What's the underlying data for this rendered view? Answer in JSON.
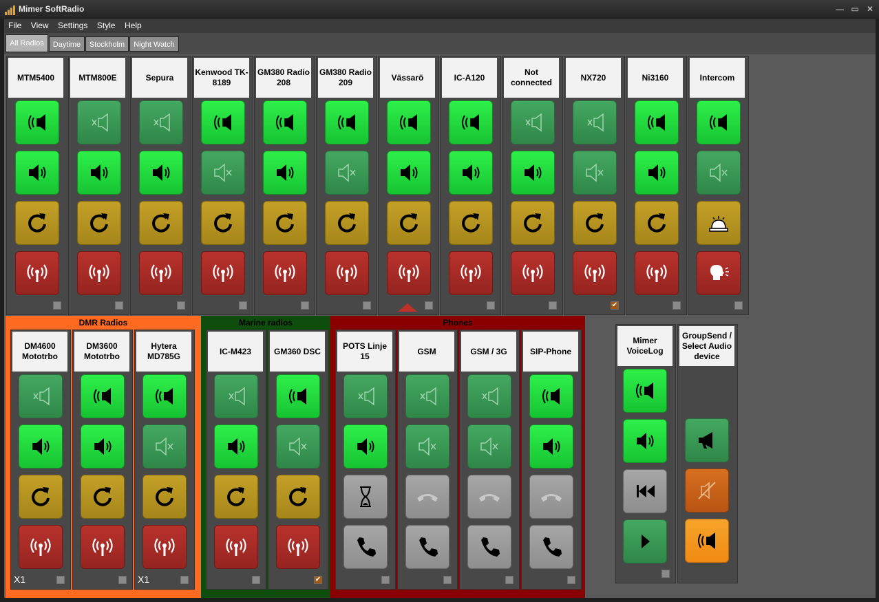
{
  "window": {
    "title": "Mimer SoftRadio"
  },
  "menu": [
    "File",
    "View",
    "Settings",
    "Style",
    "Help"
  ],
  "tabs": [
    "All Radios",
    "Daytime",
    "Stockholm",
    "Night Watch"
  ],
  "top_radios": [
    {
      "label": "MTM5400",
      "ptt": true,
      "speaker": true,
      "btn3": "refresh",
      "btn4": "antenna",
      "checked": false
    },
    {
      "label": "MTM800E",
      "ptt": false,
      "speaker": true,
      "btn3": "refresh",
      "btn4": "antenna",
      "checked": false
    },
    {
      "label": "Sepura",
      "ptt": false,
      "speaker": true,
      "btn3": "refresh",
      "btn4": "antenna",
      "checked": false
    },
    {
      "label": "Kenwood TK-8189",
      "ptt": true,
      "speaker": false,
      "btn3": "refresh",
      "btn4": "antenna",
      "checked": false
    },
    {
      "label": "GM380 Radio 208",
      "ptt": true,
      "speaker": true,
      "btn3": "refresh",
      "btn4": "antenna",
      "checked": false
    },
    {
      "label": "GM380 Radio 209",
      "ptt": true,
      "speaker": false,
      "btn3": "refresh",
      "btn4": "antenna",
      "checked": false
    },
    {
      "label": "Vässarö",
      "ptt": true,
      "speaker": true,
      "btn3": "refresh",
      "btn4": "antenna",
      "checked": false,
      "selected": true
    },
    {
      "label": "IC-A120",
      "ptt": true,
      "speaker": true,
      "btn3": "refresh",
      "btn4": "antenna",
      "checked": false
    },
    {
      "label": "Not connected",
      "ptt": false,
      "speaker": true,
      "btn3": "refresh",
      "btn4": "antenna",
      "checked": false
    },
    {
      "label": "NX720",
      "ptt": false,
      "speaker": false,
      "btn3": "refresh",
      "btn4": "antenna",
      "checked": true
    },
    {
      "label": "Ni3160",
      "ptt": true,
      "speaker": true,
      "btn3": "refresh",
      "btn4": "antenna",
      "checked": false
    },
    {
      "label": "Intercom",
      "ptt": true,
      "speaker": false,
      "btn3": "bell",
      "btn4": "voice",
      "checked": false
    }
  ],
  "groups": [
    {
      "name": "DMR Radios",
      "color": "#ff6a21",
      "radios": [
        {
          "label": "DM4600 Mototrbo",
          "ptt": false,
          "speaker": true,
          "btn3": "refresh",
          "btn4": "antenna",
          "checked": false,
          "tag": "X1"
        },
        {
          "label": "DM3600 Mototrbo",
          "ptt": true,
          "speaker": true,
          "btn3": "refresh",
          "btn4": "antenna",
          "checked": false,
          "tag": ""
        },
        {
          "label": "Hytera MD785G",
          "ptt": true,
          "speaker": false,
          "btn3": "refresh",
          "btn4": "antenna",
          "checked": false,
          "tag": "X1"
        }
      ]
    },
    {
      "name": "Marine radios",
      "color": "#0f4d0f",
      "radios": [
        {
          "label": "IC-M423",
          "ptt": false,
          "speaker": true,
          "btn3": "refresh",
          "btn4": "antenna",
          "checked": false,
          "tag": ""
        },
        {
          "label": "GM360 DSC",
          "ptt": true,
          "speaker": false,
          "btn3": "refresh",
          "btn4": "antenna",
          "checked": true,
          "tag": ""
        }
      ]
    },
    {
      "name": "Phones",
      "color": "#8a0000",
      "radios": [
        {
          "label": "POTS Linje 15",
          "ptt": false,
          "speaker": true,
          "btn3": "hourglass",
          "btn4": "phone",
          "checked": false,
          "tag": ""
        },
        {
          "label": "GSM",
          "ptt": false,
          "speaker": false,
          "btn3": "hangup",
          "btn4": "phone",
          "checked": false,
          "tag": ""
        },
        {
          "label": "GSM / 3G",
          "ptt": false,
          "speaker": false,
          "btn3": "hangup",
          "btn4": "phone",
          "checked": false,
          "tag": ""
        },
        {
          "label": "SIP-Phone",
          "ptt": true,
          "speaker": true,
          "btn3": "hangup",
          "btn4": "phone",
          "checked": false,
          "tag": ""
        }
      ]
    }
  ],
  "voicelog": {
    "label": "Mimer VoiceLog",
    "checked": false
  },
  "groupsend": {
    "label": "GroupSend / Select Audio device"
  }
}
